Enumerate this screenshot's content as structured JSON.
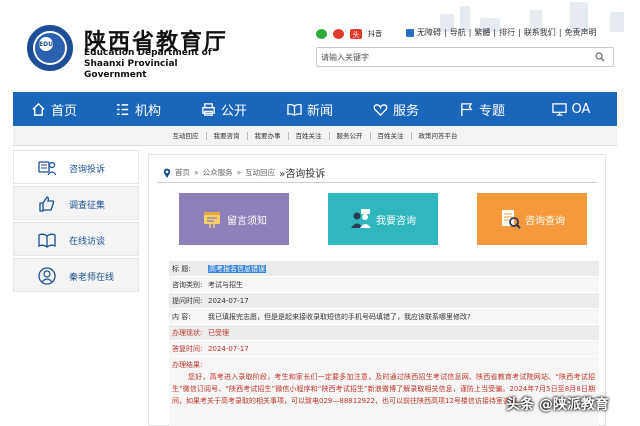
{
  "header": {
    "title_cn": "陕西省教育厅",
    "title_en_line1": "Education Department of",
    "title_en_line2": "Shaanxi Provincial Government",
    "logo_text": "EDU",
    "social": {
      "toutiao": "头条",
      "douyin": "抖音"
    },
    "links": [
      "无障碍",
      "导航",
      "繁體",
      "排行",
      "联系我们",
      "免责声明"
    ],
    "search_placeholder": "请输入关键字"
  },
  "nav": {
    "items": [
      {
        "label": "首页",
        "icon": "home-icon"
      },
      {
        "label": "机构",
        "icon": "org-icon"
      },
      {
        "label": "公开",
        "icon": "print-icon"
      },
      {
        "label": "新闻",
        "icon": "book-icon"
      },
      {
        "label": "服务",
        "icon": "heart-icon"
      },
      {
        "label": "专题",
        "icon": "flag-icon"
      },
      {
        "label": "OA",
        "icon": "monitor-icon"
      }
    ],
    "subnav": [
      "互动回应",
      "我要咨询",
      "我要办事",
      "百姓关注",
      "服务公开",
      "百姓关注",
      "政策问答平台"
    ]
  },
  "sidebar": {
    "items": [
      {
        "label": "咨询投诉",
        "icon": "consult-icon"
      },
      {
        "label": "调查征集",
        "icon": "thumbs-up-icon"
      },
      {
        "label": "在线访谈",
        "icon": "book-icon"
      },
      {
        "label": "秦老师在线",
        "icon": "person-icon"
      }
    ]
  },
  "breadcrumb": {
    "items": [
      "首页",
      "公众服务",
      "互动回应"
    ],
    "current": "咨询投诉"
  },
  "cards": [
    {
      "label": "留言须知",
      "color": "#8d7fb8"
    },
    {
      "label": "我要咨询",
      "color": "#2fb6bf"
    },
    {
      "label": "咨询查询",
      "color": "#f49a3d"
    }
  ],
  "detail": {
    "title_k": "标 题:",
    "title_v": "高考报名信息错误",
    "category_k": "咨询类别:",
    "category_v": "考试与招生",
    "submit_k": "提问时间:",
    "submit_v": "2024-07-17",
    "content_k": "内 容:",
    "content_v": "我已填报完志愿，但是是起来接收录取短信的手机号码填错了，我应该联系哪里修改?",
    "status_k": "办理现状:",
    "status_v": "已受理",
    "reply_time_k": "答复时间:",
    "reply_time_v": "2024-07-17",
    "result_k": "办理结果:",
    "result_v": "您好，高考进入录取阶段，考生和家长们一定要多加注意，及时通过陕西招生考试信息网、陕西省教育考试院网站、“陕西考试招生”微信订阅号、“陕西考试招生”微信小程序和“陕西考试招生”新浪微博了解录取相关信息，谨防上当受骗。2024年7月5日至8月8日期间，如果考关于高考录取的相关事项，可以致电029—88812922，也可以前往陕西高项12号楼信访接待室咨询。"
  },
  "watermark": "头条 @陕派教育",
  "colors": {
    "nav_blue": "#1a66bb",
    "accent_red": "#c0322a",
    "highlight": "#3a85de"
  }
}
